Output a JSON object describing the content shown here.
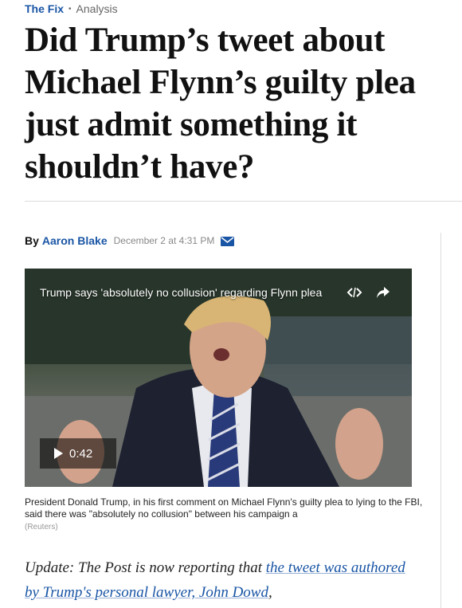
{
  "kicker": {
    "section": "The Fix",
    "separator": "•",
    "label": "Analysis"
  },
  "headline": "Did Trump’s tweet about Michael Flynn’s guilty plea just admit something it shouldn’t have?",
  "byline": {
    "by": "By",
    "author": "Aaron Blake",
    "date": "December 2 at 4:31 PM",
    "mail_icon": "envelope-icon"
  },
  "video": {
    "title": "Trump says 'absolutely no collusion' regarding Flynn plea",
    "embed_icon": "embed-code-icon",
    "share_icon": "share-arrow-icon",
    "play_icon": "play-icon",
    "duration": "0:42"
  },
  "caption": "President Donald Trump, in his first comment on Michael Flynn's guilty plea to lying to the FBI, said there was \"absolutely no collusion\" between his campaign a",
  "credit": "(Reuters)",
  "body": {
    "lead": "Update: The Post is now reporting that ",
    "link": "the tweet was authored by Trump's personal lawyer, John Dowd",
    "trail": ","
  },
  "colors": {
    "link": "#1955a5",
    "text": "#111111",
    "muted": "#888888",
    "rule": "#dcdcdc"
  }
}
